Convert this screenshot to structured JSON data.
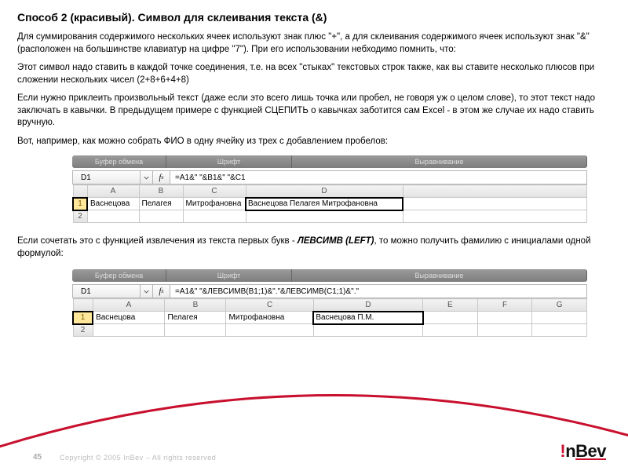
{
  "title": "Способ 2 (красивый).  Символ для склеивания текста  (&)",
  "para1": "Для суммирования содержимого нескольких ячеек используют знак плюс \"+\", а для склеивания содержимого ячеек используют знак \"&\" (расположен на большинстве клавиатур на цифре \"7\"). При его использовании небходимо помнить, что:",
  "para2": "Этот символ надо ставить в каждой точке соединения, т.е. на всех \"стыках\" текстовых строк также, как вы ставите несколько плюсов при сложении нескольких чисел (2+8+6+4+8)",
  "para3": "Если нужно приклеить произвольный текст (даже если это всего лишь точка или пробел, не говоря уж о целом слове), то этот текст надо заключать в кавычки. В предыдущем примере с функцией СЦЕПИТЬ о кавычках заботится сам Excel - в этом же случае их надо ставить вручную.",
  "para4": "Вот, например, как можно собрать ФИО в одну ячейку из трех с добавлением пробелов:",
  "para5_a": "Если сочетать это с функцией извлечения из текста первых букв - ",
  "para5_b": "ЛЕВСИМВ (LEFT)",
  "para5_c": ", то можно получить фамилию с инициалами одной формулой:",
  "ribbon": {
    "s1": "Буфер обмена",
    "s2": "Шрифт",
    "s3": "Выравнивание"
  },
  "sheet1": {
    "namebox": "D1",
    "formula": "=A1&\" \"&B1&\" \"&C1",
    "cols": [
      "A",
      "B",
      "C",
      "D"
    ],
    "row1": {
      "A": "Васнецова",
      "B": "Пелагея",
      "C": "Митрофановна",
      "D": "Васнецова Пелагея Митрофановна"
    }
  },
  "sheet2": {
    "namebox": "D1",
    "formula": "=A1&\" \"&ЛЕВСИМВ(B1;1)&\".\"&ЛЕВСИМВ(C1;1)&\".\"",
    "cols": [
      "A",
      "B",
      "C",
      "D",
      "E",
      "F",
      "G"
    ],
    "row1": {
      "A": "Васнецова",
      "B": "Пелагея",
      "C": "Митрофановна",
      "D": "Васнецова П.М."
    }
  },
  "footer": {
    "page": "45",
    "copyright": "Copyright © 2005 InBev – All rights reserved",
    "logo_bang": "!",
    "logo_text1": "n",
    "logo_text2": "Bev"
  }
}
